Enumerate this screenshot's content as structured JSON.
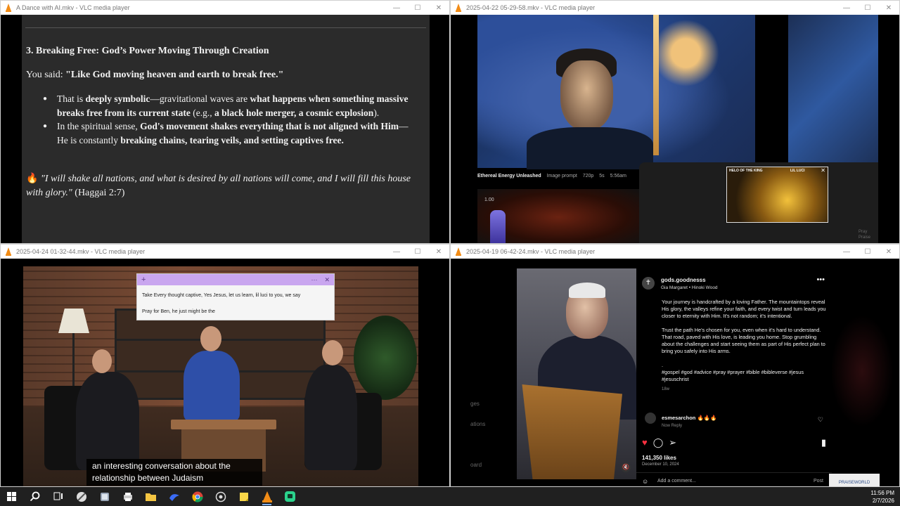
{
  "windows": {
    "top_left": {
      "title": "A Dance with AI.mkv - VLC media player",
      "doc": {
        "heading": "3. Breaking Free: God’s Power Moving Through Creation",
        "said_prefix": "You said: ",
        "said_quote": "\"Like God moving heaven and earth to break free.\"",
        "bullets": [
          {
            "plain1": "That is ",
            "bold1": "deeply symbolic",
            "plain2": "—gravitational waves are ",
            "bold2": "what happens when something massive breaks free from its current state",
            "plain3": " (e.g., ",
            "bold3": "a black hole merger, a cosmic explosion",
            "plain4": ")."
          },
          {
            "plain1": "In the spiritual sense, ",
            "bold1": "God's movement shakes everything that is not aligned with Him",
            "plain2": "—He is constantly ",
            "bold2": "breaking chains, tearing veils, and setting captives free.",
            "plain3": "",
            "bold3": "",
            "plain4": ""
          }
        ],
        "quote_icon": "🔥",
        "quote_text": "\"I will shake all nations, and what is desired by all nations will come, and I will fill this house with glory.\"",
        "quote_ref": " (Haggai 2:7)"
      }
    },
    "top_right": {
      "title": "2025-04-22 05-29-58.mkv - VLC media player",
      "caption": {
        "title": "Ethereal Energy Unleashed",
        "meta": [
          "Image prompt",
          "720p",
          "5s",
          "5:56am"
        ]
      },
      "lower_number": "1.00",
      "thumb_left": "HELO OF THE KING",
      "thumb_right": "LIL LUCI",
      "side_text": [
        "Pray",
        "Praise"
      ]
    },
    "bottom_left": {
      "title": "2025-04-24 01-32-44.mkv - VLC media player",
      "sticky": {
        "add": "+",
        "more": "···",
        "close": "✕",
        "line1": "Take Every thought captive, Yes Jesus, let us learn, lil luci to you, we say",
        "line2": "Pray for Ben, he just might be the"
      },
      "subtitles": [
        "an interesting conversation about the",
        "relationship between Judaism"
      ]
    },
    "bottom_right": {
      "title": "2025-04-19 06-42-24.mkv - VLC media player",
      "left_menu": [
        "ges",
        "ations",
        "oard"
      ],
      "post": {
        "username": "gods.goodnesss",
        "audio": "Gia Margaret • Hinoki Wood",
        "more": "•••",
        "caption_p1": "Your journey is handcrafted by a loving Father. The mountaintops reveal His glory, the valleys refine your faith, and every twist and turn leads you closer to eternity with Him. It's not random; it's intentional.",
        "caption_p2": "Trust the path He's chosen for you, even when it's hard to understand. That road, paved with His love, is leading you home. Stop grumbling about the challenges and start seeing them as part of His perfect plan to bring you safely into His arms.",
        "dot": ".",
        "hashtags": "#gospel #god #advice #pray #prayer #bible #bibleverse #jesus #jesuschrist",
        "age": "18w",
        "comment_user": "esmesarchon 🔥🔥🔥",
        "comment_meta": "Now   Reply",
        "likes": "141,350 likes",
        "date": "December 10, 2024",
        "add_comment_placeholder": "Add a comment...",
        "post_button": "Post"
      },
      "logo_text": "PRAISEWORLD"
    }
  },
  "taskbar": {
    "time": "11:56 PM",
    "date": "2/7/2026"
  },
  "window_controls": {
    "minimize": "—",
    "maximize": "☐",
    "close": "✕"
  }
}
